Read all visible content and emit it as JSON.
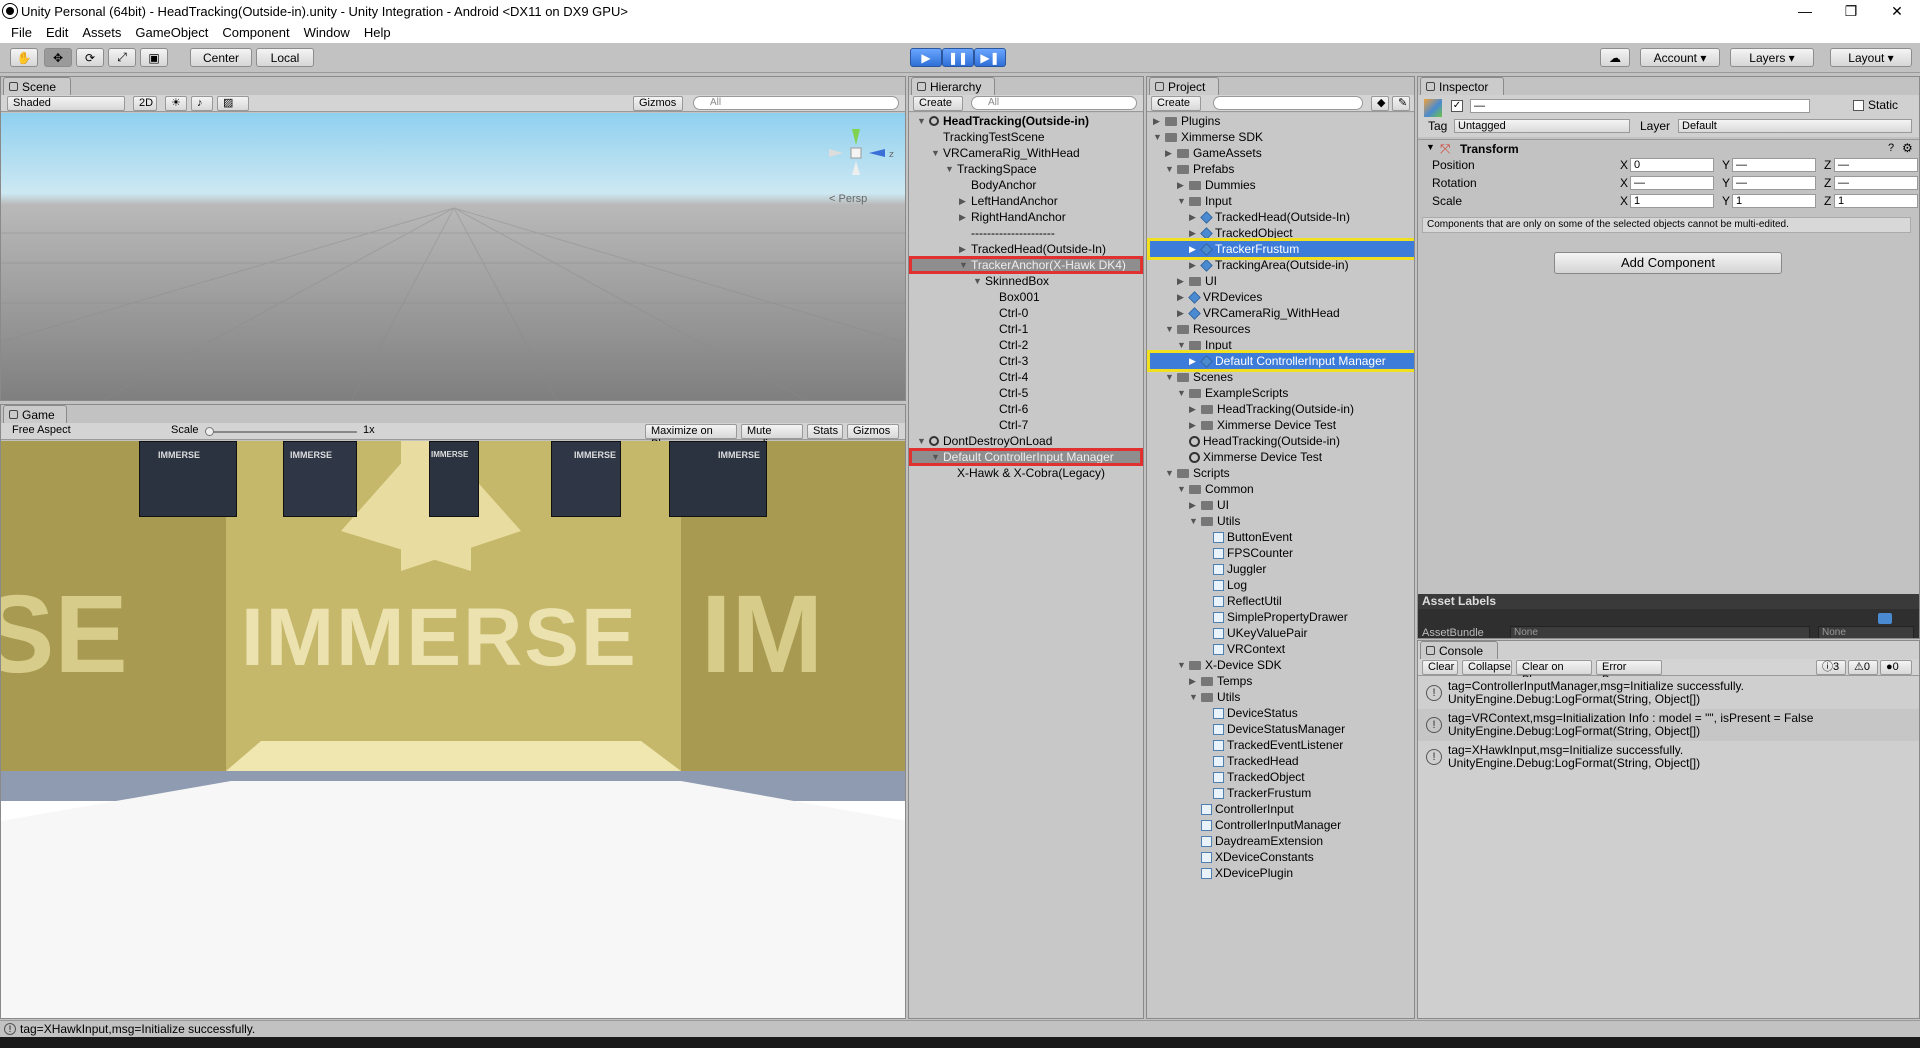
{
  "title": "Unity Personal (64bit) - HeadTracking(Outside-in).unity - Unity Integration - Android <DX11 on DX9 GPU>",
  "window_buttons": [
    "—",
    "❐",
    "✕"
  ],
  "menu": [
    "File",
    "Edit",
    "Assets",
    "GameObject",
    "Component",
    "Window",
    "Help"
  ],
  "toolbar": {
    "center": "Center",
    "local": "Local",
    "play": "▶",
    "pause": "❚❚",
    "step": "▶❚",
    "account": "Account",
    "layers": "Layers",
    "layout": "Layout"
  },
  "scene": {
    "tab": "Scene",
    "shading": "Shaded",
    "mode2d": "2D",
    "gizmos": "Gizmos",
    "search": "All",
    "persp": "Persp"
  },
  "game": {
    "tab": "Game",
    "aspect": "Free Aspect",
    "scale_label": "Scale",
    "scale_value": "1x",
    "maximize": "Maximize on Play",
    "mute": "Mute audio",
    "stats": "Stats",
    "gizmos": "Gizmos",
    "logo_text": "IMMERSE",
    "left_text": "SE",
    "right_text": "IM",
    "cube_label": "IMMERSE"
  },
  "hierarchy": {
    "tab": "Hierarchy",
    "create": "Create",
    "search": "All",
    "rows": [
      {
        "label": "HeadTracking(Outside-in)",
        "indent": 0,
        "arrow": "down",
        "bold": true
      },
      {
        "label": "TrackingTestScene",
        "indent": 1,
        "arrow": ""
      },
      {
        "label": "VRCameraRig_WithHead",
        "indent": 1,
        "arrow": "down"
      },
      {
        "label": "TrackingSpace",
        "indent": 2,
        "arrow": "down"
      },
      {
        "label": "BodyAnchor",
        "indent": 3,
        "arrow": ""
      },
      {
        "label": "LeftHandAnchor",
        "indent": 3,
        "arrow": "right"
      },
      {
        "label": "RightHandAnchor",
        "indent": 3,
        "arrow": "right"
      },
      {
        "label": "---------------------",
        "indent": 3,
        "arrow": ""
      },
      {
        "label": "TrackedHead(Outside-In)",
        "indent": 3,
        "arrow": "right"
      },
      {
        "label": "TrackerAnchor(X-Hawk DK4)",
        "indent": 3,
        "arrow": "down",
        "sel": "grey"
      },
      {
        "label": "SkinnedBox",
        "indent": 4,
        "arrow": "down"
      },
      {
        "label": "Box001",
        "indent": 5,
        "arrow": ""
      },
      {
        "label": "Ctrl-0",
        "indent": 5,
        "arrow": ""
      },
      {
        "label": "Ctrl-1",
        "indent": 5,
        "arrow": ""
      },
      {
        "label": "Ctrl-2",
        "indent": 5,
        "arrow": ""
      },
      {
        "label": "Ctrl-3",
        "indent": 5,
        "arrow": ""
      },
      {
        "label": "Ctrl-4",
        "indent": 5,
        "arrow": ""
      },
      {
        "label": "Ctrl-5",
        "indent": 5,
        "arrow": ""
      },
      {
        "label": "Ctrl-6",
        "indent": 5,
        "arrow": ""
      },
      {
        "label": "Ctrl-7",
        "indent": 5,
        "arrow": ""
      },
      {
        "label": "DontDestroyOnLoad",
        "indent": 0,
        "arrow": "down"
      },
      {
        "label": "Default ControllerInput Manager",
        "indent": 1,
        "arrow": "down",
        "sel": "grey"
      },
      {
        "label": "X-Hawk & X-Cobra(Legacy)",
        "indent": 2,
        "arrow": ""
      }
    ]
  },
  "project": {
    "tab": "Project",
    "create": "Create",
    "rows": [
      {
        "label": "Plugins",
        "indent": 0,
        "arrow": "right",
        "icon": "folder"
      },
      {
        "label": "Ximmerse SDK",
        "indent": 0,
        "arrow": "down",
        "icon": "folder"
      },
      {
        "label": "GameAssets",
        "indent": 1,
        "arrow": "right",
        "icon": "folder"
      },
      {
        "label": "Prefabs",
        "indent": 1,
        "arrow": "down",
        "icon": "folder"
      },
      {
        "label": "Dummies",
        "indent": 2,
        "arrow": "right",
        "icon": "folder"
      },
      {
        "label": "Input",
        "indent": 2,
        "arrow": "down",
        "icon": "folder"
      },
      {
        "label": "TrackedHead(Outside-In)",
        "indent": 3,
        "arrow": "right",
        "icon": "prefab"
      },
      {
        "label": "TrackedObject",
        "indent": 3,
        "arrow": "right",
        "icon": "prefab"
      },
      {
        "label": "TrackerFrustum",
        "indent": 3,
        "arrow": "right",
        "icon": "prefab",
        "sel": "blue"
      },
      {
        "label": "TrackingArea(Outside-in)",
        "indent": 3,
        "arrow": "right",
        "icon": "prefab"
      },
      {
        "label": "UI",
        "indent": 2,
        "arrow": "right",
        "icon": "folder"
      },
      {
        "label": "VRDevices",
        "indent": 2,
        "arrow": "right",
        "icon": "prefab"
      },
      {
        "label": "VRCameraRig_WithHead",
        "indent": 2,
        "arrow": "right",
        "icon": "prefab"
      },
      {
        "label": "Resources",
        "indent": 1,
        "arrow": "down",
        "icon": "folder"
      },
      {
        "label": "Input",
        "indent": 2,
        "arrow": "down",
        "icon": "folder"
      },
      {
        "label": "Default ControllerInput Manager",
        "indent": 3,
        "arrow": "right",
        "icon": "prefab",
        "sel": "blue"
      },
      {
        "label": "Scenes",
        "indent": 1,
        "arrow": "down",
        "icon": "folder"
      },
      {
        "label": "ExampleScripts",
        "indent": 2,
        "arrow": "down",
        "icon": "folder"
      },
      {
        "label": "HeadTracking(Outside-in)",
        "indent": 3,
        "arrow": "right",
        "icon": "folder"
      },
      {
        "label": "Ximmerse Device Test",
        "indent": 3,
        "arrow": "right",
        "icon": "folder"
      },
      {
        "label": "HeadTracking(Outside-in)",
        "indent": 2,
        "arrow": "",
        "icon": "scene"
      },
      {
        "label": "Ximmerse Device Test",
        "indent": 2,
        "arrow": "",
        "icon": "scene"
      },
      {
        "label": "Scripts",
        "indent": 1,
        "arrow": "down",
        "icon": "folder"
      },
      {
        "label": "Common",
        "indent": 2,
        "arrow": "down",
        "icon": "folder"
      },
      {
        "label": "UI",
        "indent": 3,
        "arrow": "right",
        "icon": "folder"
      },
      {
        "label": "Utils",
        "indent": 3,
        "arrow": "down",
        "icon": "folder"
      },
      {
        "label": "ButtonEvent",
        "indent": 4,
        "arrow": "",
        "icon": "script"
      },
      {
        "label": "FPSCounter",
        "indent": 4,
        "arrow": "",
        "icon": "script"
      },
      {
        "label": "Juggler",
        "indent": 4,
        "arrow": "",
        "icon": "script"
      },
      {
        "label": "Log",
        "indent": 4,
        "arrow": "",
        "icon": "script"
      },
      {
        "label": "ReflectUtil",
        "indent": 4,
        "arrow": "",
        "icon": "script"
      },
      {
        "label": "SimplePropertyDrawer",
        "indent": 4,
        "arrow": "",
        "icon": "script"
      },
      {
        "label": "UKeyValuePair",
        "indent": 4,
        "arrow": "",
        "icon": "script"
      },
      {
        "label": "VRContext",
        "indent": 4,
        "arrow": "",
        "icon": "script"
      },
      {
        "label": "X-Device SDK",
        "indent": 2,
        "arrow": "down",
        "icon": "folder"
      },
      {
        "label": "Temps",
        "indent": 3,
        "arrow": "right",
        "icon": "folder"
      },
      {
        "label": "Utils",
        "indent": 3,
        "arrow": "down",
        "icon": "folder"
      },
      {
        "label": "DeviceStatus",
        "indent": 4,
        "arrow": "",
        "icon": "script"
      },
      {
        "label": "DeviceStatusManager",
        "indent": 4,
        "arrow": "",
        "icon": "script"
      },
      {
        "label": "TrackedEventListener",
        "indent": 4,
        "arrow": "",
        "icon": "script"
      },
      {
        "label": "TrackedHead",
        "indent": 4,
        "arrow": "",
        "icon": "script"
      },
      {
        "label": "TrackedObject",
        "indent": 4,
        "arrow": "",
        "icon": "script"
      },
      {
        "label": "TrackerFrustum",
        "indent": 4,
        "arrow": "",
        "icon": "script"
      },
      {
        "label": "ControllerInput",
        "indent": 3,
        "arrow": "",
        "icon": "script"
      },
      {
        "label": "ControllerInputManager",
        "indent": 3,
        "arrow": "",
        "icon": "script"
      },
      {
        "label": "DaydreamExtension",
        "indent": 3,
        "arrow": "",
        "icon": "script"
      },
      {
        "label": "XDeviceConstants",
        "indent": 3,
        "arrow": "",
        "icon": "script"
      },
      {
        "label": "XDevicePlugin",
        "indent": 3,
        "arrow": "",
        "icon": "script"
      }
    ]
  },
  "inspector": {
    "tab": "Inspector",
    "name": "—",
    "static": "Static",
    "tag_label": "Tag",
    "tag_value": "Untagged",
    "layer_label": "Layer",
    "layer_value": "Default",
    "transform": "Transform",
    "rows": [
      {
        "label": "Position",
        "x": "0",
        "y": "—",
        "z": "—"
      },
      {
        "label": "Rotation",
        "x": "—",
        "y": "—",
        "z": "—"
      },
      {
        "label": "Scale",
        "x": "1",
        "y": "1",
        "z": "1"
      }
    ],
    "axes": [
      "X",
      "Y",
      "Z"
    ],
    "note": "Components that are only on some of the selected objects cannot be multi-edited.",
    "add_component": "Add Component",
    "asset_labels": "Asset Labels",
    "asset_bundle": "AssetBundle",
    "bundle_value": "None",
    "bundle_variant": "None"
  },
  "console": {
    "tab": "Console",
    "clear": "Clear",
    "collapse": "Collapse",
    "clear_on_play": "Clear on Play",
    "error_pause": "Error Pause",
    "count_info": "3",
    "count_warn": "0",
    "count_err": "0",
    "entries": [
      {
        "line1": "tag=ControllerInputManager,msg=Initialize successfully.",
        "line2": "UnityEngine.Debug:LogFormat(String, Object[])"
      },
      {
        "line1": "tag=VRContext,msg=Initialization Info : model = \"\", isPresent = False",
        "line2": "UnityEngine.Debug:LogFormat(String, Object[])"
      },
      {
        "line1": "tag=XHawkInput,msg=Initialize successfully.",
        "line2": "UnityEngine.Debug:LogFormat(String, Object[])"
      }
    ]
  },
  "status": "tag=XHawkInput,msg=Initialize successfully.",
  "colors": {
    "selection": "#3d7cd9",
    "red_box": "#e03030",
    "yellow_box": "#f0e020",
    "game_wall": "#a89a50"
  }
}
